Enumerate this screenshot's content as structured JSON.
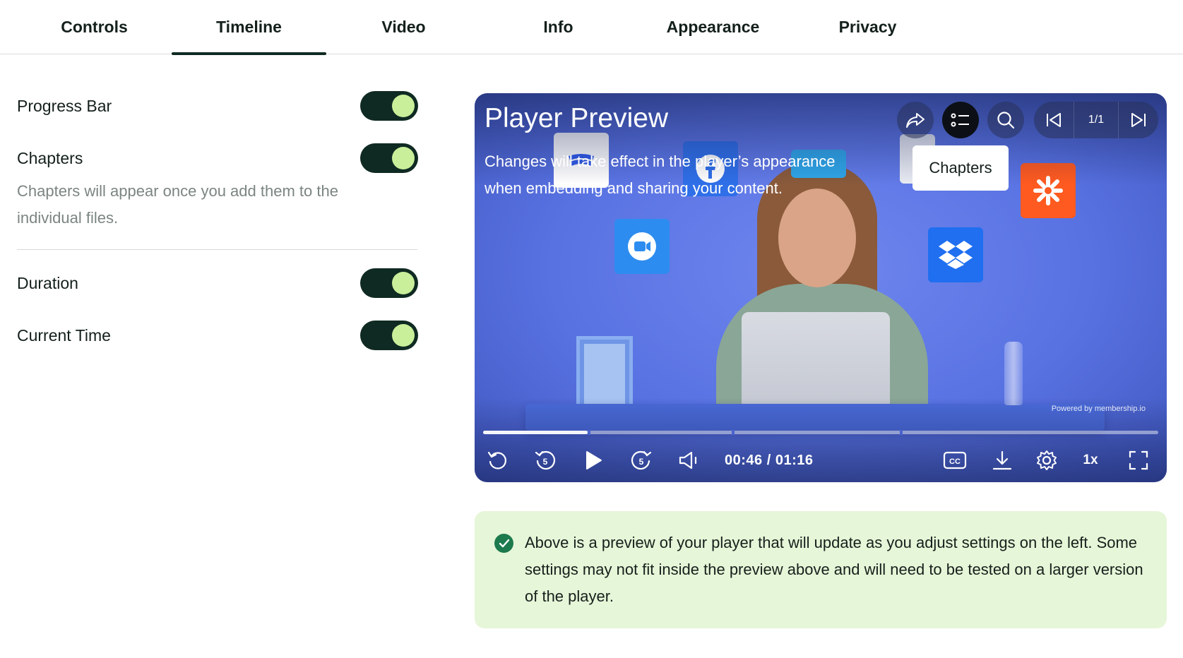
{
  "tabs": [
    {
      "label": "Controls",
      "active": false
    },
    {
      "label": "Timeline",
      "active": true
    },
    {
      "label": "Video",
      "active": false
    },
    {
      "label": "Info",
      "active": false
    },
    {
      "label": "Appearance",
      "active": false
    },
    {
      "label": "Privacy",
      "active": false
    }
  ],
  "settings": {
    "progress_bar": {
      "label": "Progress Bar",
      "enabled": true
    },
    "chapters": {
      "label": "Chapters",
      "enabled": true,
      "helper": "Chapters will appear once you add them to the individual files."
    },
    "duration": {
      "label": "Duration",
      "enabled": true
    },
    "current_time": {
      "label": "Current Time",
      "enabled": true
    }
  },
  "player": {
    "title": "Player Preview",
    "description": "Changes will take effect in the player’s appearance when embedding and sharing your content.",
    "tooltip": "Chapters",
    "chapter_counter": "1/1",
    "time_display": "00:46 / 01:16",
    "speed": "1x",
    "skip_seconds": "5",
    "powered_by": "Powered by  membership.io",
    "progress_played_fraction": 0.155,
    "colors": {
      "accent": "#c9ef9a",
      "toggle_bg": "#0f2a22",
      "player_bg": "#5872e2"
    }
  },
  "notice": {
    "icon": "check-circle-icon",
    "text": "Above is a preview of your player that will update as you adjust settings on the left. Some settings may not fit inside the preview above and will need to be tested on a larger version of the player."
  }
}
